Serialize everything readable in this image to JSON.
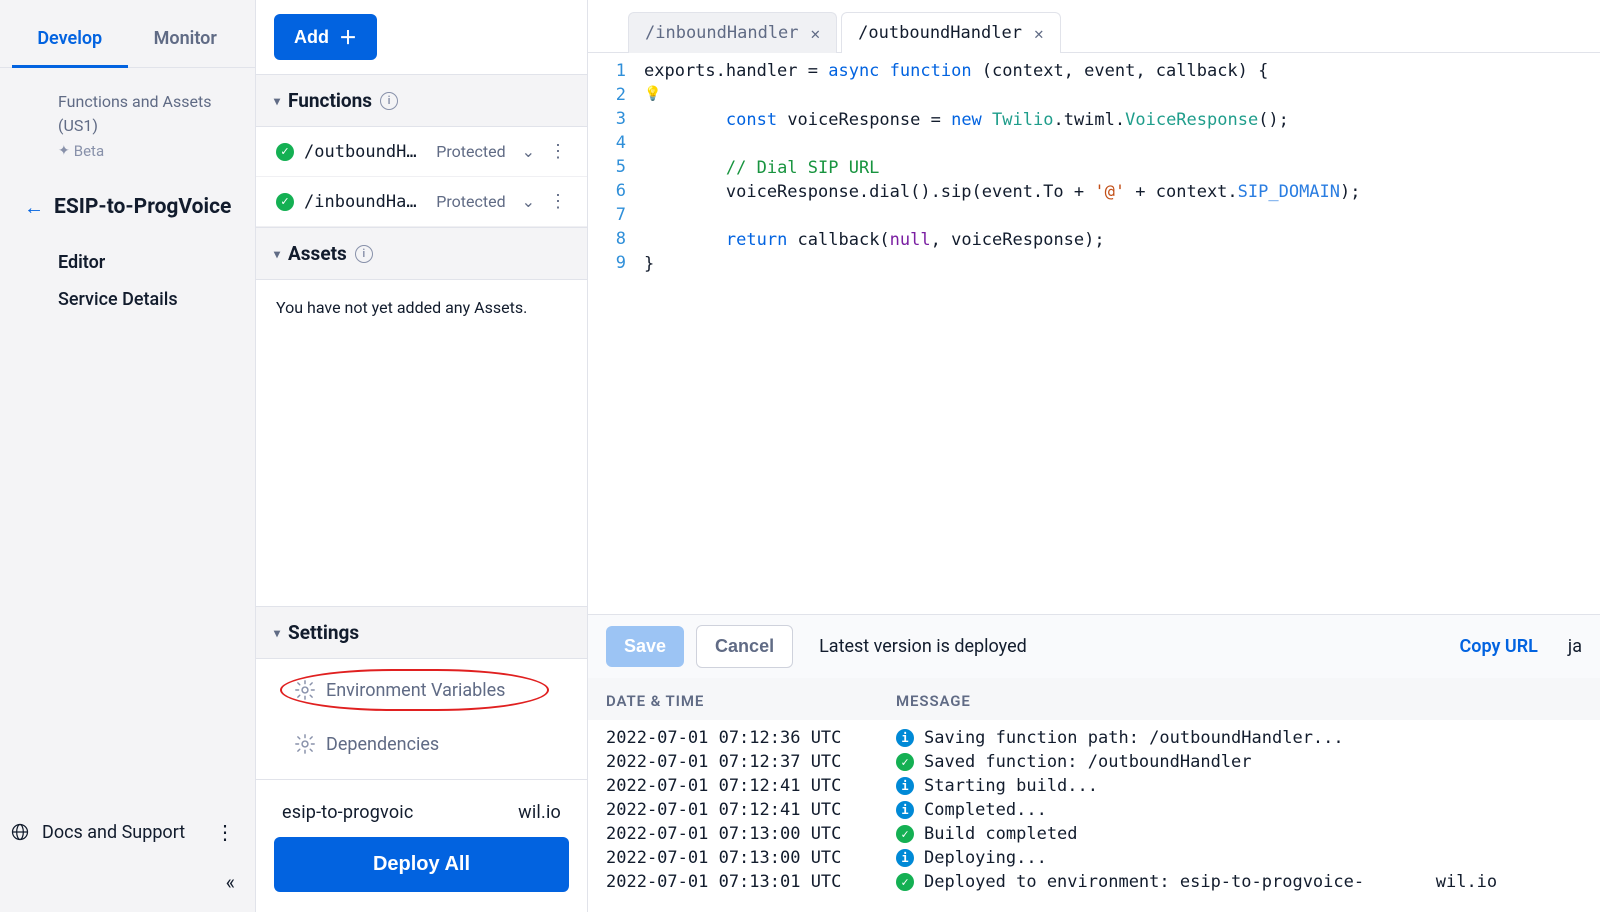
{
  "left": {
    "tabs": {
      "develop": "Develop",
      "monitor": "Monitor"
    },
    "breadcrumb": {
      "line1": "Functions and Assets",
      "line2": "(US1)",
      "beta": "Beta"
    },
    "service_name": "ESIP-to-ProgVoice",
    "nav": {
      "editor": "Editor",
      "service_details": "Service Details"
    },
    "docs": "Docs and Support"
  },
  "mid": {
    "add_label": "Add",
    "sections": {
      "functions": "Functions",
      "assets": "Assets",
      "settings": "Settings"
    },
    "functions": [
      {
        "name": "/outboundHandl…",
        "visibility": "Protected"
      },
      {
        "name": "/inboundHandler",
        "visibility": "Protected"
      }
    ],
    "assets_empty": "You have not yet added any Assets.",
    "settings_items": {
      "env": "Environment Variables",
      "deps": "Dependencies"
    },
    "deploy_url_left": "esip-to-progvoic",
    "deploy_url_right": "wil.io",
    "deploy_all": "Deploy All"
  },
  "editor": {
    "tabs": [
      {
        "name": "/inboundHandler",
        "active": false
      },
      {
        "name": "/outboundHandler",
        "active": true
      }
    ],
    "lines": [
      "1",
      "2",
      "3",
      "4",
      "5",
      "6",
      "7",
      "8",
      "9"
    ],
    "save": "Save",
    "cancel": "Cancel",
    "status": "Latest version is deployed",
    "copy": "Copy URL",
    "lang_fragment": "ja"
  },
  "log": {
    "col_dt": "DATE & TIME",
    "col_msg": "MESSAGE",
    "rows": [
      {
        "dt": "2022-07-01 07:12:36 UTC",
        "type": "info",
        "msg": "Saving function path: /outboundHandler..."
      },
      {
        "dt": "2022-07-01 07:12:37 UTC",
        "type": "ok",
        "msg": "Saved function: /outboundHandler"
      },
      {
        "dt": "2022-07-01 07:12:41 UTC",
        "type": "info",
        "msg": "Starting build..."
      },
      {
        "dt": "2022-07-01 07:12:41 UTC",
        "type": "info",
        "msg": "Completed..."
      },
      {
        "dt": "2022-07-01 07:13:00 UTC",
        "type": "ok",
        "msg": "Build completed"
      },
      {
        "dt": "2022-07-01 07:13:00 UTC",
        "type": "info",
        "msg": "Deploying..."
      },
      {
        "dt": "2022-07-01 07:13:01 UTC",
        "type": "ok",
        "msg": "Deployed to environment: esip-to-progvoice-       wil.io"
      }
    ]
  }
}
